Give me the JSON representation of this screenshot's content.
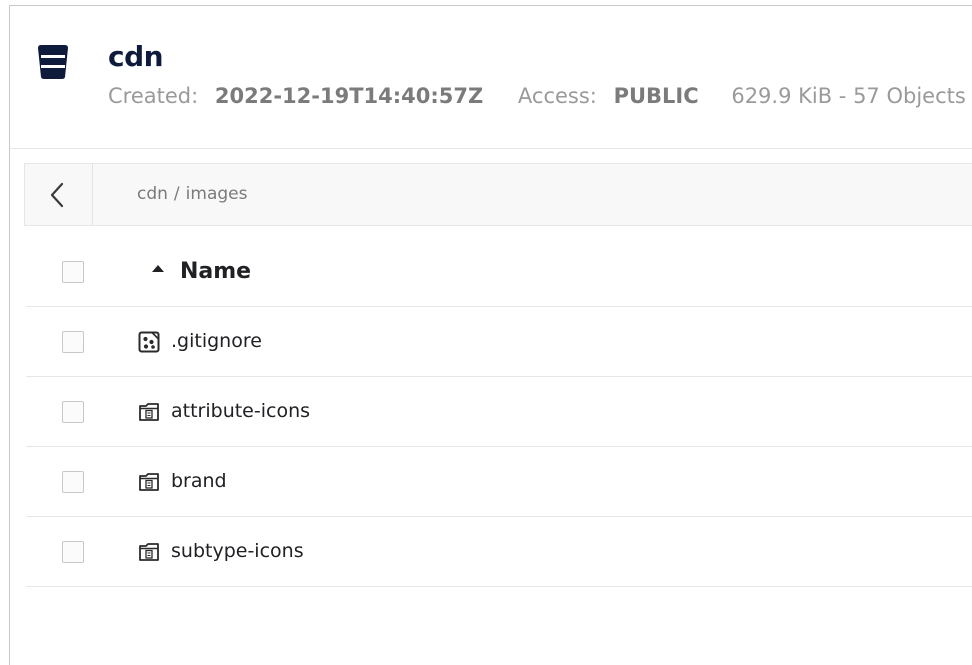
{
  "bucket": {
    "name": "cdn",
    "created_label": "Created:",
    "created_value": "2022-12-19T14:40:57Z",
    "access_label": "Access:",
    "access_value": "PUBLIC",
    "size_summary": "629.9 KiB - 57 Objects",
    "icon": "bucket-icon"
  },
  "breadcrumb": {
    "back_icon": "chevron-left-icon",
    "root": "cdn",
    "separator": "/",
    "current": "images"
  },
  "table": {
    "name_header": "Name",
    "sort_icon": "sort-ascending-icon",
    "rows": [
      {
        "name": ".gitignore",
        "icon": "file-icon"
      },
      {
        "name": "attribute-icons",
        "icon": "folder-icon"
      },
      {
        "name": "brand",
        "icon": "folder-icon"
      },
      {
        "name": "subtype-icons",
        "icon": "folder-icon"
      }
    ]
  },
  "colors": {
    "bucket_icon": "#0f1b3a",
    "muted_text": "#9a9a9a",
    "border": "#e6e6e6"
  }
}
